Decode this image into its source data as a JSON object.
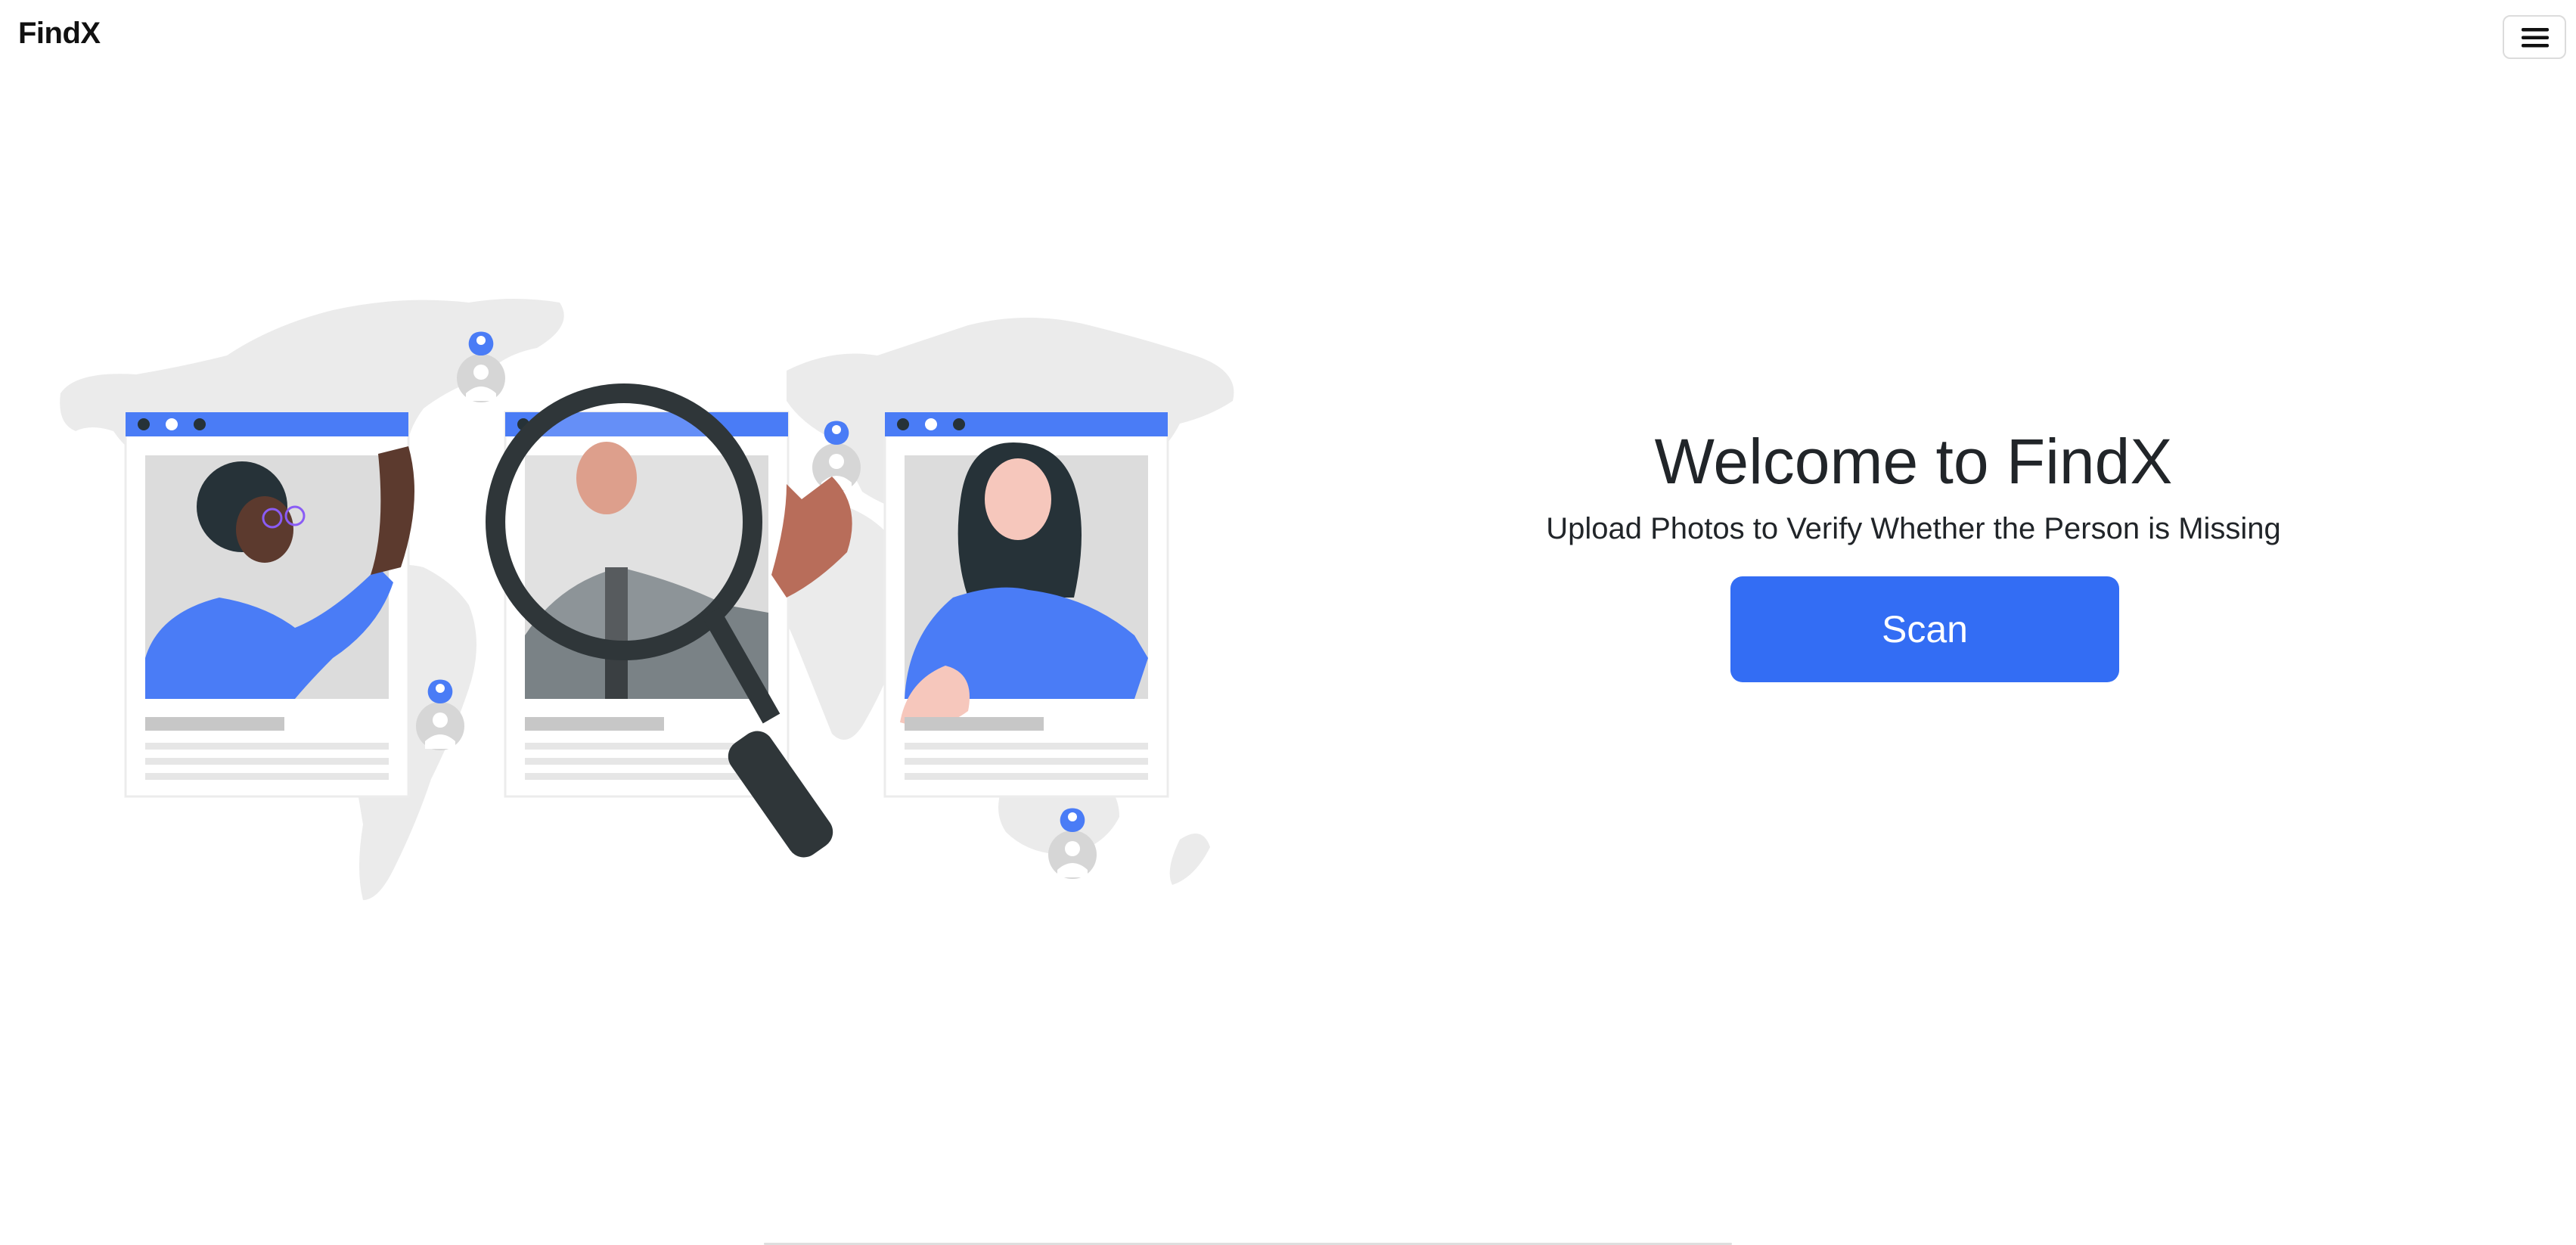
{
  "navbar": {
    "brand": "FindX",
    "menu_icon": "hamburger-icon"
  },
  "hero": {
    "title": "Welcome to FindX",
    "subtitle": "Upload Photos to Verify Whether the Person is Missing",
    "scan_label": "Scan"
  },
  "colors": {
    "accent": "#336df4",
    "illustration_blue": "#4a7cf6",
    "map_gray": "#ebebeb"
  }
}
